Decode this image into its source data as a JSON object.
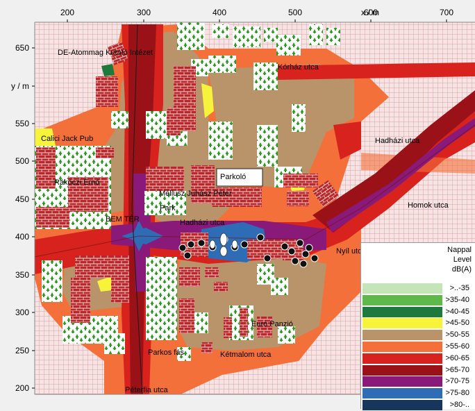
{
  "axes": {
    "x_unit_label": "x / m",
    "y_unit_label": "y / m",
    "x_ticks": [
      "200",
      "300",
      "400",
      "500",
      "600",
      "700"
    ],
    "y_ticks": [
      "650",
      "600",
      "550",
      "500",
      "450",
      "400",
      "350",
      "300",
      "250",
      "200"
    ]
  },
  "street_labels": {
    "de_atommag": "DE-Atommag Kutató Intézet",
    "korhaz": "Kórház utca",
    "calici": "Calici Jack Pub",
    "hadhazi_right": "Hadházi utca",
    "parkolo": "Parkoló",
    "rakoczi": "Rákóczi Ernő",
    "meliusz": "Méliusz Juhász Péter",
    "park": "Park",
    "homok": "Homok utca",
    "bem_ter": "BEM TÉR",
    "hadhazi_center": "Hadházi utca",
    "nyil": "Nyíl utca",
    "euro": "Euró Panzió",
    "parkos": "Parkos fás",
    "ketmalom": "Kétmalom utca",
    "peterfia": "Péterfia utca"
  },
  "legend": {
    "title_line1": "Nappal",
    "title_line2": "Level",
    "title_line3": "dB(A)",
    "items": [
      {
        "label": ">..-35",
        "color": "#c4e5b8"
      },
      {
        "label": ">35-40",
        "color": "#5fb84a"
      },
      {
        "label": ">40-45",
        "color": "#1e7a3c"
      },
      {
        "label": ">45-50",
        "color": "#f7f33a"
      },
      {
        "label": ">50-55",
        "color": "#b9936a"
      },
      {
        "label": ">55-60",
        "color": "#f4703a"
      },
      {
        "label": ">60-65",
        "color": "#d8221e"
      },
      {
        "label": ">65-70",
        "color": "#9a1218"
      },
      {
        "label": ">70-75",
        "color": "#8a1a7a"
      },
      {
        "label": ">75-80",
        "color": "#2e6db5"
      },
      {
        "label": ">80-..",
        "color": "#16365c"
      }
    ]
  },
  "colors": {
    "hatch_bg": "#f6e3e3",
    "hatch_line": "#d9a1a1",
    "building_fill": "#b8282a",
    "tree_white": "#ffffff",
    "tree_green": "#2f9a22"
  }
}
